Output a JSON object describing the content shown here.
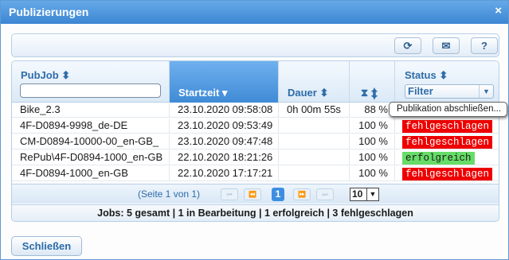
{
  "dialog": {
    "title": "Publizierungen",
    "close_glyph": "×"
  },
  "toolbar": {
    "refresh_glyph": "⟳",
    "mail_glyph": "✉",
    "help_glyph": "?"
  },
  "columns": {
    "pubjob": "PubJob ⬍",
    "startzeit": "Startzeit ▾",
    "dauer": "Dauer ⬍",
    "progress": "⧗ ⬍",
    "status": "Status ⬍"
  },
  "filters": {
    "pubjob_value": "",
    "status_selected": "Filter"
  },
  "rows": [
    {
      "pubjob": "Bike_2.3",
      "startzeit": "23.10.2020 09:58:08",
      "dauer": "0h 00m 55s",
      "progress": "88 %",
      "status": ""
    },
    {
      "pubjob": "4F-D0894-9998_de-DE",
      "startzeit": "23.10.2020 09:53:49",
      "dauer": "",
      "progress": "100 %",
      "status": "fehlgeschlagen"
    },
    {
      "pubjob": "CM-D0894-10000-00_en-GB_",
      "startzeit": "23.10.2020 09:47:48",
      "dauer": "",
      "progress": "100 %",
      "status": "fehlgeschlagen"
    },
    {
      "pubjob": "RePub\\4F-D0894-1000_en-GB",
      "startzeit": "22.10.2020 18:21:26",
      "dauer": "",
      "progress": "100 %",
      "status": "erfolgreich"
    },
    {
      "pubjob": "4F-D0894-1000_en-GB",
      "startzeit": "22.10.2020 17:17:21",
      "dauer": "",
      "progress": "100 %",
      "status": "fehlgeschlagen"
    }
  ],
  "status_colors": {
    "fehlgeschlagen": "#ee0000",
    "erfolgreich": "#66dd66"
  },
  "pager": {
    "info": "(Seite 1 von 1)",
    "current_page": "1",
    "page_size": "10",
    "first": "⏮",
    "prev": "⏪",
    "next": "⏩",
    "last": "⏭"
  },
  "summary": "Jobs: 5 gesamt | 1 in Bearbeitung | 1 erfolgreich | 3 fehlgeschlagen",
  "tooltip": "Publikation abschließen...",
  "close_button": "Schließen"
}
